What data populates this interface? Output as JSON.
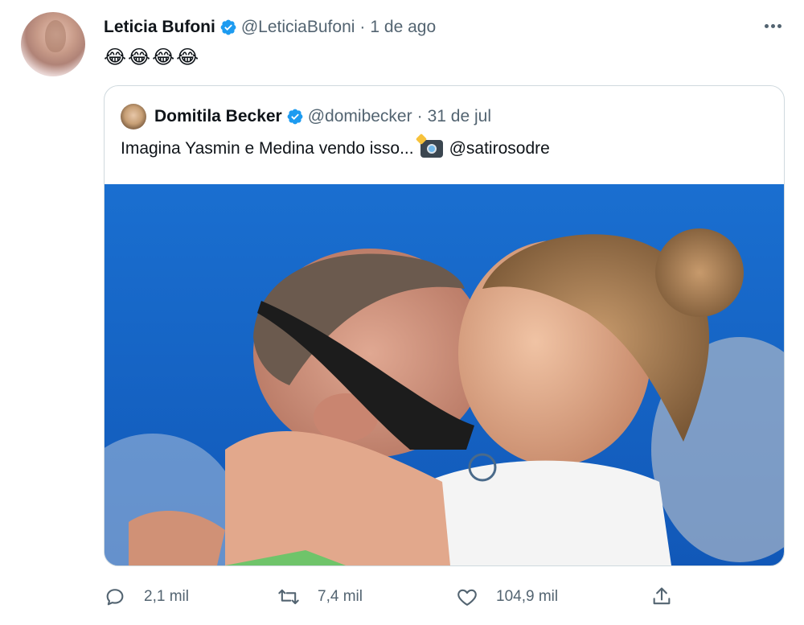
{
  "tweet": {
    "author_name": "Leticia Bufoni",
    "author_handle": "@LeticiaBufoni",
    "separator": "·",
    "time": "1 de ago",
    "text": "😂😂😂😂",
    "more_icon": "more-horizontal-icon",
    "verified_icon": "verified-badge-icon"
  },
  "quoted": {
    "author_name": "Domitila Becker",
    "author_handle": "@domibecker",
    "separator": "·",
    "time": "31 de jul",
    "text_before": "Imagina Yasmin e Medina vendo isso...",
    "text_icon": "camera-flash-icon",
    "text_after": "@satirosodre",
    "photo_background_color": "#1565c8"
  },
  "actions": {
    "reply_count": "2,1 mil",
    "retweet_count": "7,4 mil",
    "like_count": "104,9 mil",
    "share_icon": "share-icon"
  },
  "colors": {
    "text": "#0f1419",
    "secondary_text": "#536471",
    "verified": "#1d9bf0",
    "border": "#cfd9de"
  }
}
